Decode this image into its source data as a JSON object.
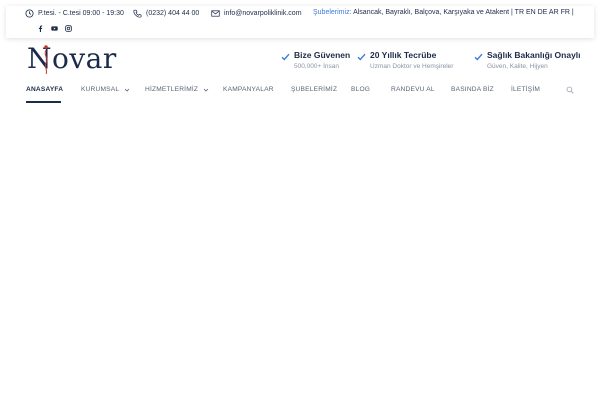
{
  "topbar": {
    "hours": "P.tesi. - C.tesi 09:00 - 19:30",
    "phone": "(0232) 404 44 00",
    "email": "info@novarpoliklinik.com",
    "branches_label": "Şubelerimiz:",
    "branches_list": " Alsancak, Bayraklı, Balçova, Karşıyaka ve Atakent | TR EN DE AR FR |",
    "social": [
      "facebook-icon",
      "youtube-icon",
      "instagram-icon"
    ]
  },
  "logo": {
    "text": "Novar"
  },
  "features": [
    {
      "title": "Bize Güvenen",
      "subtitle": "500,000+ İnsan"
    },
    {
      "title": "20 Yıllık Tecrübe",
      "subtitle": "Uzman Doktor ve Hemşireler"
    },
    {
      "title": "Sağlık Bakanlığı Onaylı",
      "subtitle": "Güven, Kalite, Hijyen"
    }
  ],
  "nav": {
    "items": [
      {
        "label": "ANASAYFA",
        "active": true,
        "dropdown": false
      },
      {
        "label": "KURUMSAL",
        "active": false,
        "dropdown": true
      },
      {
        "label": "HİZMETLERİMİZ",
        "active": false,
        "dropdown": true
      },
      {
        "label": "KAMPANYALAR",
        "active": false,
        "dropdown": false
      },
      {
        "label": "ŞUBELERİMİZ",
        "active": false,
        "dropdown": false
      },
      {
        "label": "BLOG",
        "active": false,
        "dropdown": false
      },
      {
        "label": "RANDEVU AL",
        "active": false,
        "dropdown": false
      },
      {
        "label": "BASINDA BİZ",
        "active": false,
        "dropdown": false
      },
      {
        "label": "İLETİŞİM",
        "active": false,
        "dropdown": false
      }
    ]
  },
  "colors": {
    "navy": "#1c2b4a",
    "accent_blue": "#3d7bd9",
    "muted_gray": "#8a93a5"
  }
}
